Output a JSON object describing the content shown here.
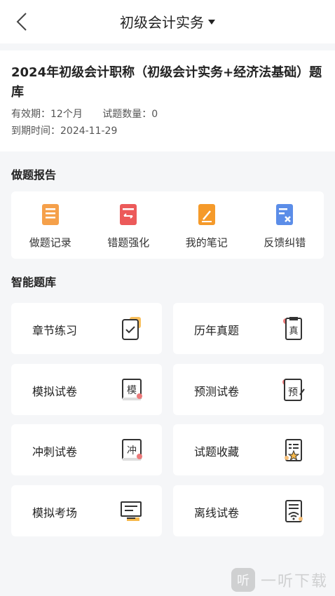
{
  "header": {
    "title": "初级会计实务"
  },
  "bank": {
    "title": "2024年初级会计职称（初级会计实务+经济法基础）题库",
    "validity": "有效期：12个月",
    "question_count": "试题数量：0",
    "expiry": "到期时间：2024-11-29"
  },
  "report": {
    "section_title": "做题报告",
    "items": [
      {
        "label": "做题记录",
        "icon": "record-icon",
        "color": "#f5a04a"
      },
      {
        "label": "错题强化",
        "icon": "wrong-question-icon",
        "color": "#ec5a5a"
      },
      {
        "label": "我的笔记",
        "icon": "notes-icon",
        "color": "#f59a2a"
      },
      {
        "label": "反馈纠错",
        "icon": "feedback-icon",
        "color": "#5b8de8"
      }
    ]
  },
  "smart": {
    "section_title": "智能题库",
    "tiles": [
      {
        "label": "章节练习",
        "icon": "chapter-practice-icon"
      },
      {
        "label": "历年真题",
        "icon": "past-papers-icon",
        "glyph": "真"
      },
      {
        "label": "模拟试卷",
        "icon": "mock-paper-icon",
        "glyph": "模"
      },
      {
        "label": "预测试卷",
        "icon": "forecast-paper-icon",
        "glyph": "预"
      },
      {
        "label": "冲刺试卷",
        "icon": "sprint-paper-icon",
        "glyph": "冲"
      },
      {
        "label": "试题收藏",
        "icon": "favorites-icon"
      },
      {
        "label": "模拟考场",
        "icon": "mock-exam-room-icon"
      },
      {
        "label": "离线试卷",
        "icon": "offline-paper-icon"
      }
    ]
  },
  "watermark": {
    "text": "一听下载",
    "logo_glyph": "听"
  },
  "colors": {
    "accent_orange": "#f5a04a",
    "accent_red": "#ec5a5a",
    "accent_blue": "#5b8de8",
    "background": "#f5f6f8"
  }
}
